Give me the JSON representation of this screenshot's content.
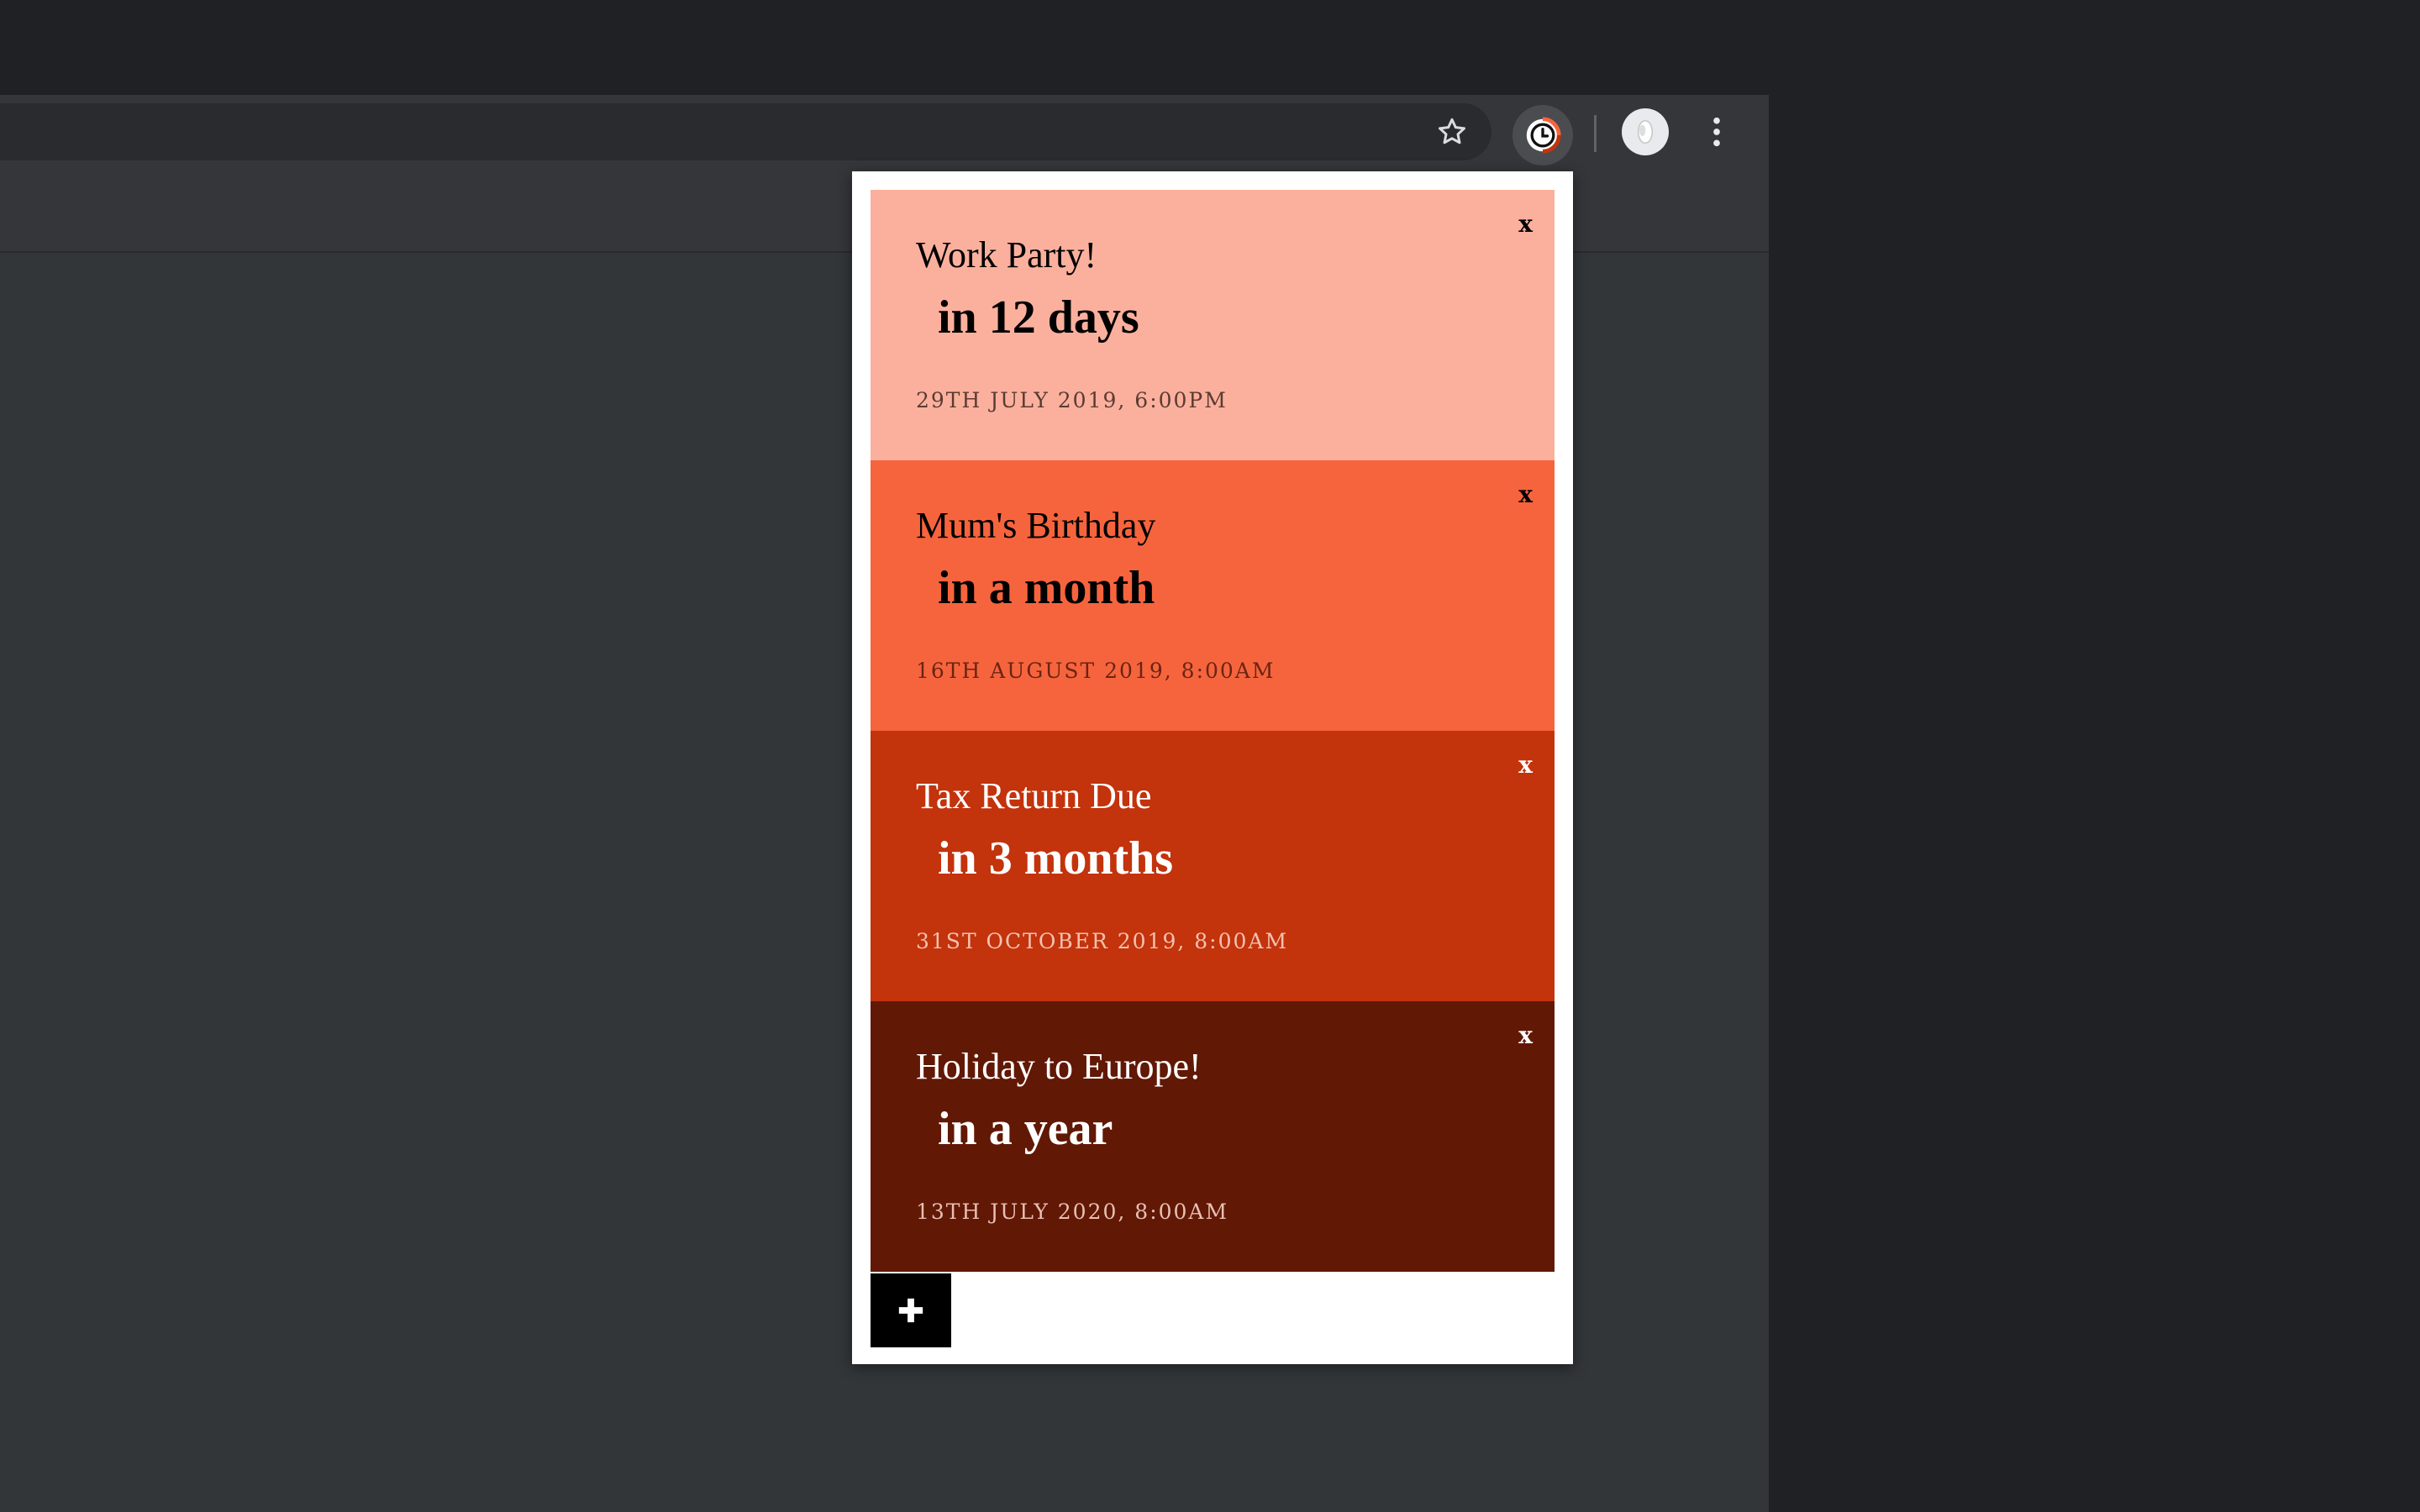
{
  "browser": {
    "icons": {
      "bookmark": "star-icon",
      "extension": "clock-icon",
      "profile": "avatar-icon",
      "menu": "kebab-menu-icon"
    }
  },
  "popup": {
    "cards": [
      {
        "title": "Work Party!",
        "countdown": "in 12 days",
        "date": "29th July 2019, 6:00pm",
        "close": "x",
        "bg": "#fbb09d",
        "fg": "#000000",
        "date_color": "#5a3b33"
      },
      {
        "title": "Mum's Birthday",
        "countdown": "in a month",
        "date": "16th August 2019, 8:00am",
        "close": "x",
        "bg": "#f6643d",
        "fg": "#000000",
        "date_color": "#6a2412"
      },
      {
        "title": "Tax Return Due",
        "countdown": "in 3 months",
        "date": "31st October 2019, 8:00am",
        "close": "x",
        "bg": "#c3330c",
        "fg": "#ffffff",
        "date_color": "#f3c2b0"
      },
      {
        "title": "Holiday to Europe!",
        "countdown": "in a year",
        "date": "13th July 2020, 8:00am",
        "close": "x",
        "bg": "#611805",
        "fg": "#ffffff",
        "date_color": "#e9bfb3"
      }
    ],
    "add_icon": "plus-icon"
  }
}
